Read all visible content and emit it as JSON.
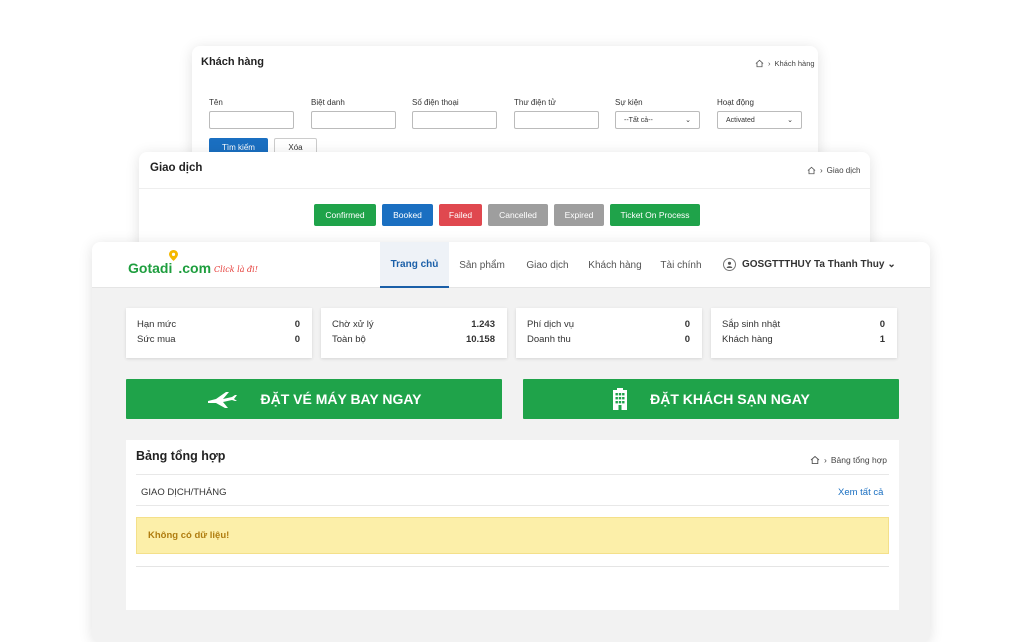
{
  "customers": {
    "title": "Khách hàng",
    "breadcrumb": "Khách hàng",
    "fields": [
      {
        "label": "Tên",
        "value": ""
      },
      {
        "label": "Biệt danh",
        "value": ""
      },
      {
        "label": "Số điện thoại",
        "value": ""
      },
      {
        "label": "Thư điện tử",
        "value": ""
      },
      {
        "label": "Sự kiện",
        "value": "--Tất cả--"
      },
      {
        "label": "Hoạt động",
        "value": "Activated"
      }
    ],
    "search_label": "Tìm kiếm",
    "clear_label": "Xóa"
  },
  "transactions": {
    "title": "Giao dịch",
    "breadcrumb": "Giao dịch",
    "statuses": [
      {
        "label": "Confirmed",
        "color": "#1fa34a"
      },
      {
        "label": "Booked",
        "color": "#1a6fc1"
      },
      {
        "label": "Failed",
        "color": "#e0484f"
      },
      {
        "label": "Cancelled",
        "color": "#9e9e9e"
      },
      {
        "label": "Expired",
        "color": "#9e9e9e"
      },
      {
        "label": "Ticket On Process",
        "color": "#1fa34a"
      }
    ]
  },
  "header": {
    "logo_main": "Gotadi",
    "logo_tld": ".com",
    "logo_slogan": "Click là đi!",
    "nav": [
      "Trang chủ",
      "Sản phẩm",
      "Giao dịch",
      "Khách hàng",
      "Tài chính"
    ],
    "active_nav": "Trang chủ",
    "user": "GOSGTTTHUY Ta Thanh Thuy"
  },
  "stats": [
    [
      {
        "label": "Hạn mức",
        "value": "0"
      },
      {
        "label": "Sức mua",
        "value": "0"
      }
    ],
    [
      {
        "label": "Chờ xử lý",
        "value": "1.243"
      },
      {
        "label": "Toàn bộ",
        "value": "10.158"
      }
    ],
    [
      {
        "label": "Phí dịch vụ",
        "value": "0"
      },
      {
        "label": "Doanh thu",
        "value": "0"
      }
    ],
    [
      {
        "label": "Sắp sinh nhật",
        "value": "0"
      },
      {
        "label": "Khách hàng",
        "value": "1"
      }
    ]
  ],
  "actions": {
    "flight": "ĐẶT VÉ MÁY BAY NGAY",
    "hotel": "ĐẶT KHÁCH SẠN NGAY"
  },
  "summary": {
    "title": "Bảng tổng hợp",
    "breadcrumb": "Bảng tổng hợp",
    "section": "GIAO DỊCH/THÁNG",
    "view_all": "Xem tất cả",
    "empty": "Không có dữ liệu!"
  },
  "colors": {
    "brand_green": "#1fa34a",
    "primary_blue": "#1a6fc1"
  }
}
